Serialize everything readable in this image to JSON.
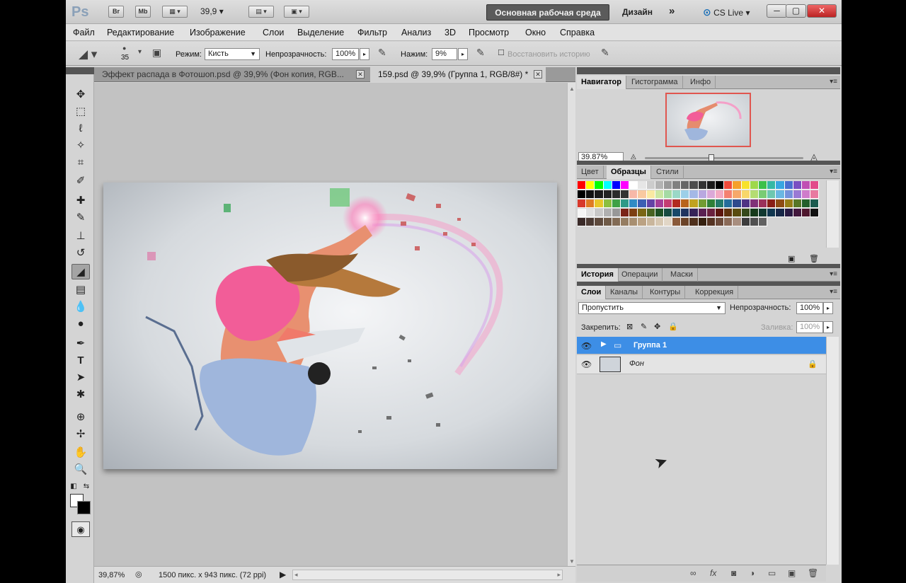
{
  "titlebar": {
    "logo": "Ps",
    "bridge": "Br",
    "minibridge": "Mb",
    "zoom": "39,9",
    "workspace": "Основная рабочая среда",
    "design": "Дизайн",
    "cslive": "CS Live"
  },
  "menu": [
    "Файл",
    "Редактирование",
    "Изображение",
    "Слои",
    "Выделение",
    "Фильтр",
    "Анализ",
    "3D",
    "Просмотр",
    "Окно",
    "Справка"
  ],
  "options": {
    "brush_size": "35",
    "mode_label": "Режим:",
    "mode_value": "Кисть",
    "opacity_label": "Непрозрачность:",
    "opacity_value": "100%",
    "flow_label": "Нажим:",
    "flow_value": "9%",
    "restore_label": "Восстановить историю"
  },
  "documents": [
    {
      "title": "Эффект распада в Фотошоп.psd @ 39,9% (Фон копия, RGB..."
    },
    {
      "title": "159.psd @ 39,9% (Группа 1, RGB/8#) *"
    }
  ],
  "status": {
    "zoom": "39,87%",
    "info": "1500 пикс. x 943 пикс. (72 ppi)"
  },
  "navigator": {
    "tabs": [
      "Навигатор",
      "Гистограмма",
      "Инфо"
    ],
    "zoom": "39.87%"
  },
  "swatches": {
    "tabs": [
      "Цвет",
      "Образцы",
      "Стили"
    ],
    "rows": [
      [
        "#ff0000",
        "#ffff00",
        "#00ff00",
        "#00ffff",
        "#0000ff",
        "#ff00ff",
        "#ffffff",
        "#e6e6e6",
        "#cccccc",
        "#b3b3b3",
        "#999999",
        "#808080",
        "#666666",
        "#4d4d4d",
        "#333333",
        "#1a1a1a",
        "#000000",
        "#f04a3a",
        "#f5a02a",
        "#f7e22b",
        "#9ed84b",
        "#3cc04a",
        "#36b8a4",
        "#39a6e1",
        "#4a6fd0",
        "#7a4fc2",
        "#c04fb3",
        "#e24a8a"
      ],
      [
        "#000000",
        "#111111",
        "#1a1a1a",
        "#222222",
        "#2b2b2b",
        "#333333",
        "#f7b8a8",
        "#f8c9a0",
        "#f9e9a2",
        "#cbe7a3",
        "#a5dba4",
        "#9ad8c7",
        "#9ccfe8",
        "#a4b8e6",
        "#b9a8e0",
        "#dba8d8",
        "#f2a9c2",
        "#f48070",
        "#f6a86a",
        "#f8d76a",
        "#b4dc72",
        "#79cc74",
        "#6dc7b0",
        "#6ab7e2",
        "#7592db",
        "#9a7ad4",
        "#cf7ccb",
        "#e87aa0"
      ],
      [
        "#d8392b",
        "#e07b23",
        "#e8c62a",
        "#8cbf3f",
        "#3fa146",
        "#2f9a87",
        "#2f8bc4",
        "#3b5fb3",
        "#6443a6",
        "#a43f98",
        "#c43e72",
        "#b22a20",
        "#b8631c",
        "#c0a220",
        "#729c32",
        "#2f8038",
        "#247a6a",
        "#246d9b",
        "#2e4a8d",
        "#4f3484",
        "#813178",
        "#9b305a",
        "#8a1e17",
        "#8e4b14",
        "#957d17",
        "#577726",
        "#235f2a",
        "#1b5b4f"
      ],
      [
        "#f5f5f5",
        "#e0e0e0",
        "#c8c8c8",
        "#b0b0b0",
        "#989898",
        "#7a2418",
        "#7d3f12",
        "#7a6615",
        "#486321",
        "#1e5024",
        "#164b41",
        "#17496a",
        "#1f3460",
        "#362358",
        "#5a2152",
        "#6a213e",
        "#5c150f",
        "#5e320e",
        "#5a4c10",
        "#35491a",
        "#163a1b",
        "#103830",
        "#10364f",
        "#172747",
        "#291a42",
        "#43183d",
        "#4f172e",
        "#111111"
      ],
      [
        "#3a2a28",
        "#4b3a33",
        "#5e4a3d",
        "#6f5a47",
        "#826b55",
        "#957d62",
        "#a88f71",
        "#bba283",
        "#c9b69c",
        "#d6c7b1",
        "#e1d6c6",
        "#8a5a3a",
        "#6b4328",
        "#4f301c",
        "#35200f",
        "#553322",
        "#6b4a3a",
        "#8a6a58",
        "#a88e7f",
        "#3d3d3d",
        "#4f4f4f",
        "#616161"
      ]
    ]
  },
  "history": {
    "tabs": [
      "История",
      "Операции",
      "Маски"
    ]
  },
  "layers": {
    "tabs": [
      "Слои",
      "Каналы",
      "Контуры",
      "Коррекция"
    ],
    "blend": "Пропустить",
    "opacity_label": "Непрозрачность:",
    "opacity_value": "100%",
    "lock_label": "Закрепить:",
    "fill_label": "Заливка:",
    "fill_value": "100%",
    "items": [
      {
        "name": "Группа 1"
      },
      {
        "name": "Фон"
      }
    ]
  },
  "colors": {
    "selection": "#3d8ee6",
    "workspace_btn": "#5b5b5b",
    "close_btn": "#c83232"
  }
}
